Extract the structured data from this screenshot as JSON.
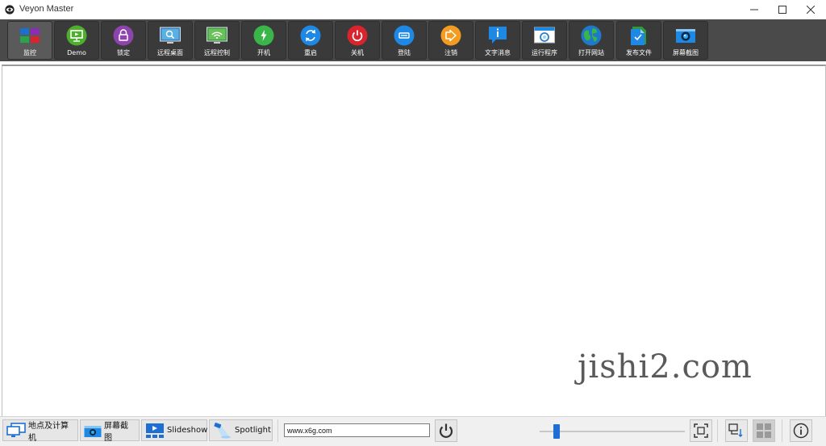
{
  "window": {
    "title": "Veyon Master"
  },
  "toolbar": {
    "buttons": [
      {
        "id": "monitor",
        "label": "监控",
        "icon": "monitor-grid-icon"
      },
      {
        "id": "demo",
        "label": "Demo",
        "icon": "presentation-icon"
      },
      {
        "id": "lock",
        "label": "锁定",
        "icon": "lock-icon"
      },
      {
        "id": "remote-view",
        "label": "远程桌面",
        "icon": "remote-view-icon"
      },
      {
        "id": "remote-control",
        "label": "远程控制",
        "icon": "remote-control-icon"
      },
      {
        "id": "power-on",
        "label": "开机",
        "icon": "power-on-icon"
      },
      {
        "id": "reboot",
        "label": "重启",
        "icon": "reboot-icon"
      },
      {
        "id": "power-off",
        "label": "关机",
        "icon": "power-off-icon"
      },
      {
        "id": "login",
        "label": "登陆",
        "icon": "login-icon"
      },
      {
        "id": "logout",
        "label": "注销",
        "icon": "logout-icon"
      },
      {
        "id": "text-message",
        "label": "文字消息",
        "icon": "text-message-icon"
      },
      {
        "id": "run-program",
        "label": "运行程序",
        "icon": "run-program-icon"
      },
      {
        "id": "open-website",
        "label": "打开网站",
        "icon": "globe-icon"
      },
      {
        "id": "transfer-file",
        "label": "发布文件",
        "icon": "file-transfer-icon"
      },
      {
        "id": "screenshot",
        "label": "屏幕截图",
        "icon": "camera-icon"
      }
    ]
  },
  "watermark": "jishi2.com",
  "statusbar": {
    "locations_label": "地点及计算机",
    "screenshots_label": "屏幕截图",
    "slideshow_label": "Slideshow",
    "spotlight_label": "Spotlight",
    "url_value": "www.x6g.com",
    "zoom_slider_value": 0.12
  },
  "colors": {
    "toolbar_bg": "#4a4a4a",
    "accent_blue": "#1e6fd4",
    "power_green": "#3ab54a",
    "power_red": "#d9232d",
    "orange": "#f39c1f"
  }
}
